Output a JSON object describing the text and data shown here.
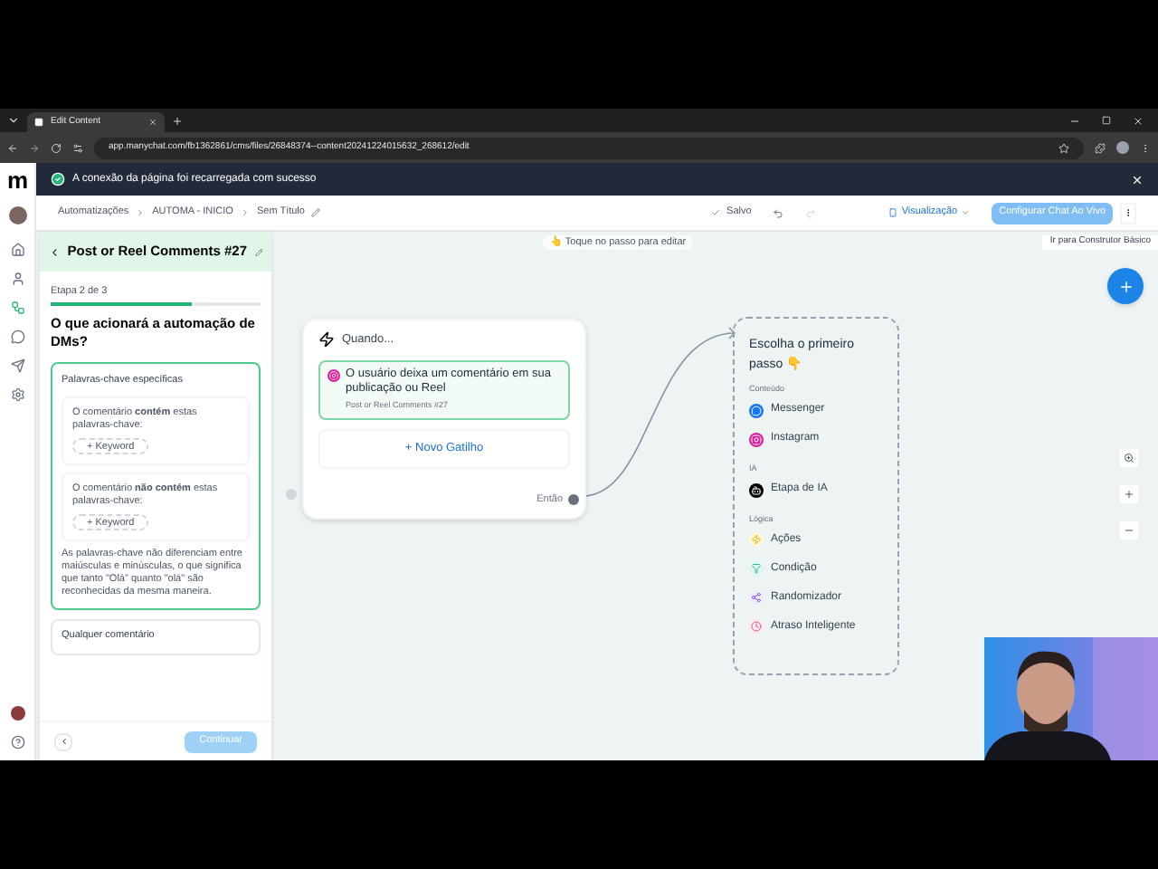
{
  "browser": {
    "tab_title": "Edit Content",
    "url": "app.manychat.com/fb1362861/cms/files/26848374--content20241224015632_268612/edit"
  },
  "notification": {
    "text": "A conexão da página foi recarregada com sucesso"
  },
  "sidebar": {
    "logo": "m",
    "items": [
      {
        "kind": "home",
        "selected": false
      },
      {
        "kind": "contacts",
        "selected": false
      },
      {
        "kind": "automation",
        "selected": true
      },
      {
        "kind": "chat",
        "selected": false
      },
      {
        "kind": "broadcast",
        "selected": false
      },
      {
        "kind": "settings",
        "selected": false
      }
    ]
  },
  "header": {
    "breadcrumb": [
      "Automatizações",
      "AUTOMA - INICIO",
      "Sem Título"
    ],
    "status": "Salvo",
    "preview": "Visualização",
    "live_chat_button": "Configurar Chat Ao Vivo"
  },
  "panel": {
    "title": "Post or Reel Comments #27",
    "step": "Etapa 2 de 3",
    "level": 0.67,
    "question": "O que acionará a automação de DMs?",
    "keyword_section": {
      "title": "Palavras-chave específicas",
      "selected": true,
      "groups": [
        {
          "text": "O comentário **contém** estas palavras-chave:",
          "button": "+ Keyword"
        },
        {
          "text": "O comentário **não contém** estas palavras-chave:",
          "button": "+ Keyword"
        }
      ],
      "note": "As palavras-chave não diferenciam entre maiúsculas e minúsculas, o que significa que tanto \"Olá\" quanto \"olá\" são reconhecidas da mesma maneira."
    },
    "other_option": {
      "title": "Qualquer comentário",
      "selected": false
    },
    "continue_button": {
      "label": "Continuar",
      "disabled": true
    }
  },
  "canvas": {
    "hint": "👆 Toque no passo para editar",
    "basic_builder": "Ir para Construtor Básico",
    "trigger_node": {
      "title": "Quando...",
      "trigger": "O usuário deixa um comentário em sua publicação ou Reel",
      "trigger_subtitle": "Post or Reel Comments #27",
      "new_trigger": "+ Novo Gatilho",
      "next_label": "Então"
    },
    "step_chooser": {
      "title": "Escolha o primeiro passo 👇",
      "groups": [
        {
          "label": "Conteúdo",
          "items": [
            {
              "label": "Messenger",
              "kind": "messenger"
            },
            {
              "label": "Instagram",
              "kind": "instagram"
            }
          ]
        },
        {
          "label": "IA",
          "items": [
            {
              "label": "Etapa de IA",
              "kind": "ai"
            }
          ]
        },
        {
          "label": "Lógica",
          "items": [
            {
              "label": "Ações",
              "kind": "actions"
            },
            {
              "label": "Condição",
              "kind": "condition"
            },
            {
              "label": "Randomizador",
              "kind": "randomizer"
            },
            {
              "label": "Atraso Inteligente",
              "kind": "delay"
            }
          ]
        }
      ]
    }
  }
}
